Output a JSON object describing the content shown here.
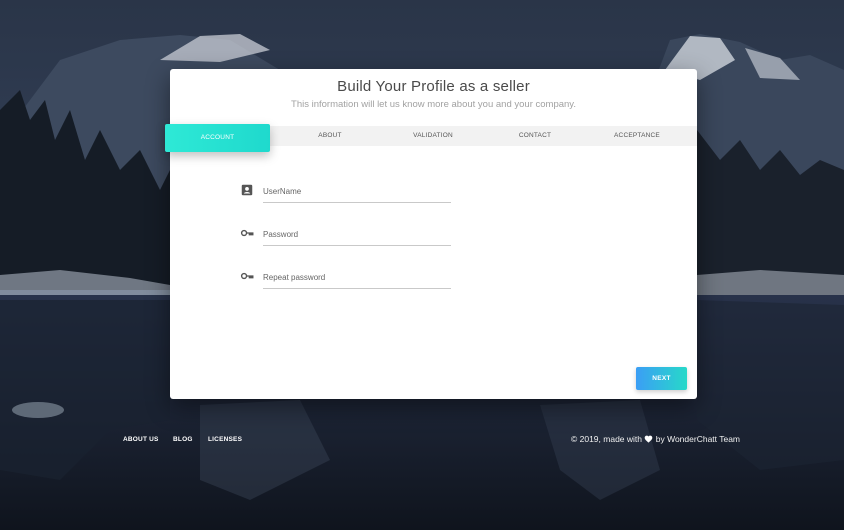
{
  "card": {
    "title": "Build Your Profile as a seller",
    "subtitle": "This information will let us know more about you and your company."
  },
  "tabs": [
    {
      "label": "ACCOUNT",
      "active": true
    },
    {
      "label": "ABOUT",
      "active": false
    },
    {
      "label": "VALIDATION",
      "active": false
    },
    {
      "label": "CONTACT",
      "active": false
    },
    {
      "label": "ACCEPTANCE",
      "active": false
    }
  ],
  "form": {
    "username": {
      "placeholder": "UserName",
      "value": "",
      "icon": "account-box-icon"
    },
    "password": {
      "placeholder": "Password",
      "value": "",
      "icon": "key-icon"
    },
    "repeat_password": {
      "placeholder": "Repeat password",
      "value": "",
      "icon": "key-icon"
    }
  },
  "next_button": {
    "label": "NEXT"
  },
  "footer": {
    "links": [
      "ABOUT US",
      "BLOG",
      "LICENSES"
    ],
    "credit_prefix": "© 2019, made with",
    "credit_suffix": "by WonderChatt Team"
  },
  "colors": {
    "accent_active_tab": "#2ee9d6",
    "button_gradient_start": "#3b9ef5",
    "button_gradient_end": "#27d9c9",
    "card_background": "#ffffff"
  }
}
